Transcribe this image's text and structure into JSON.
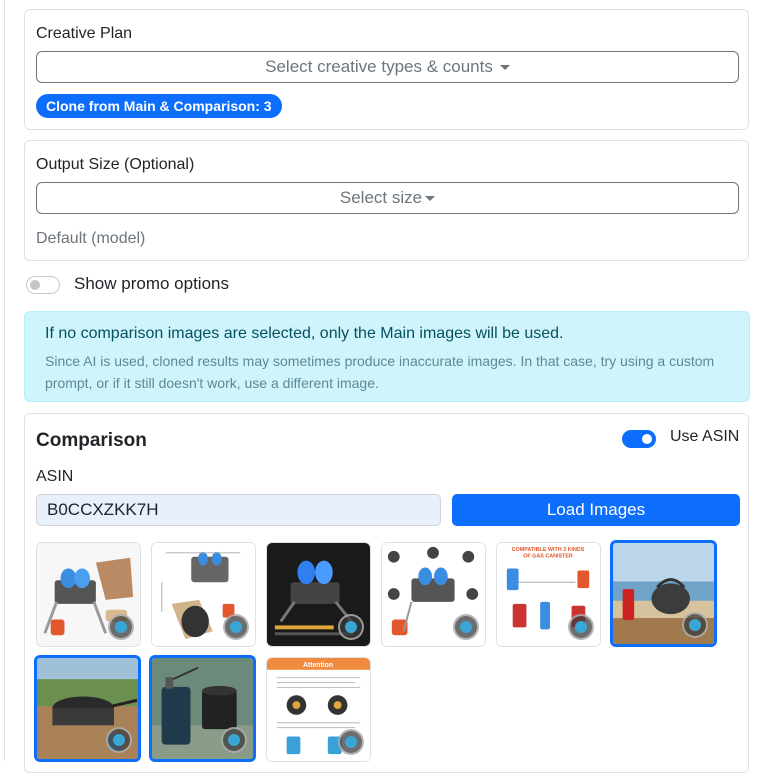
{
  "creative_plan": {
    "label": "Creative Plan",
    "select_placeholder": "Select creative types & counts",
    "badge": "Clone from Main & Comparison: 3"
  },
  "output_size": {
    "label": "Output Size (Optional)",
    "select_placeholder": "Select size",
    "default_text": "Default (model)"
  },
  "promo": {
    "label": "Show promo options",
    "enabled": false
  },
  "alert": {
    "main": "If no comparison images are selected, only the Main images will be used.",
    "sub": "Since AI is used, cloned results may sometimes produce inaccurate images. In that case, try using a custom prompt, or if it still doesn't work, use a different image."
  },
  "comparison": {
    "title": "Comparison",
    "use_asin_label": "Use ASIN",
    "use_asin_enabled": true,
    "asin_label": "ASIN",
    "asin_value": "B0CCXZKK7H",
    "load_button": "Load Images",
    "images": [
      {
        "id": "stove-hero-with-bag",
        "selected": false
      },
      {
        "id": "stove-dimensions-and-case",
        "selected": false
      },
      {
        "id": "stove-high-energy-dark",
        "selected": false
      },
      {
        "id": "stove-parts-callouts",
        "selected": false
      },
      {
        "id": "compatible-gas-canisters",
        "selected": false,
        "caption": "COMPATIBLE WITH 3 KINDS OF GAS CANISTER"
      },
      {
        "id": "kettle-on-beach",
        "selected": true
      },
      {
        "id": "pot-outdoor-camping",
        "selected": true
      },
      {
        "id": "stove-with-canister-outdoor",
        "selected": true
      },
      {
        "id": "attention-instructions",
        "selected": false,
        "caption": "Attention"
      }
    ]
  },
  "colors": {
    "primary": "#0d6efd",
    "alert_bg": "#cff4fc",
    "alert_text": "#055160",
    "muted": "#6c757d"
  }
}
